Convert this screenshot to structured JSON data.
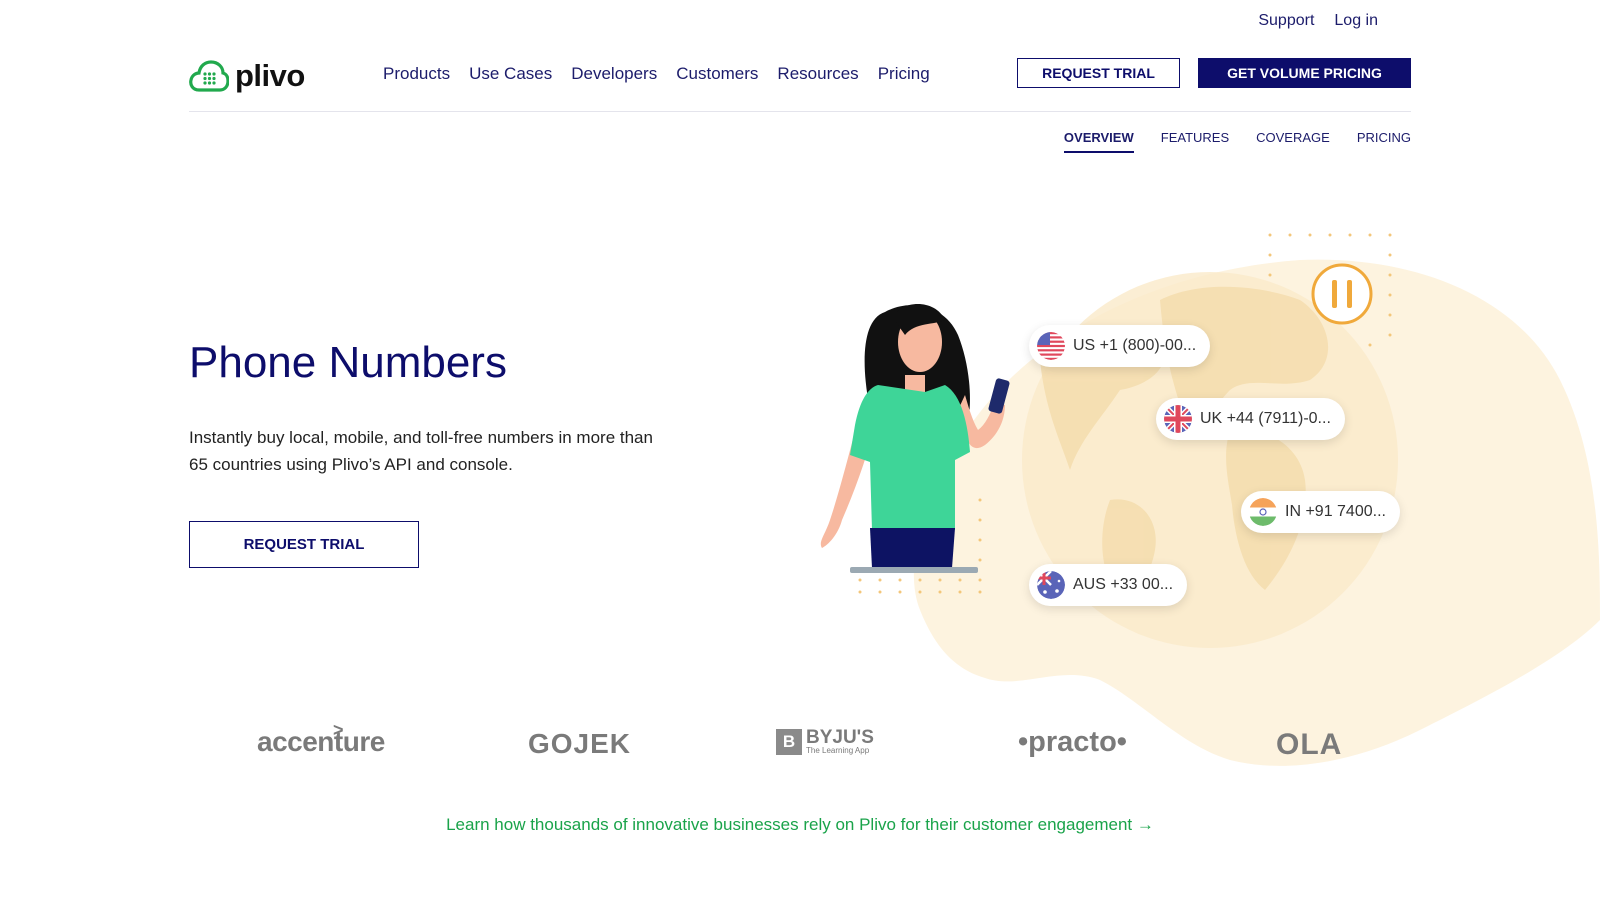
{
  "topbar": {
    "support": "Support",
    "login": "Log in"
  },
  "brand": {
    "name": "plivo",
    "color": "#21a94d"
  },
  "nav": {
    "items": [
      "Products",
      "Use Cases",
      "Developers",
      "Customers",
      "Resources",
      "Pricing"
    ]
  },
  "header_buttons": {
    "request_trial": "REQUEST TRIAL",
    "volume_pricing": "GET VOLUME PRICING"
  },
  "subnav": {
    "items": [
      "OVERVIEW",
      "FEATURES",
      "COVERAGE",
      "PRICING"
    ],
    "active": "OVERVIEW"
  },
  "hero": {
    "title": "Phone Numbers",
    "description": "Instantly buy local, mobile, and toll-free numbers in more than 65 countries using Plivo’s API and console.",
    "button": "REQUEST TRIAL"
  },
  "numbers": {
    "us": "US +1 (800)-00...",
    "uk": "UK +44 (7911)-0...",
    "in": "IN +91 7400...",
    "aus": "AUS +33 00..."
  },
  "customer_logos": [
    "accenture",
    "GOJEK",
    "BYJU'S",
    "The Learning App",
    "practo",
    "OLA"
  ],
  "cta": {
    "text": "Learn how thousands of innovative businesses rely on Plivo for their customer engagement →"
  },
  "colors": {
    "navy": "#0d0d6b",
    "green": "#21a94d",
    "cream": "#fdf3df",
    "shirt": "#3ed598",
    "pause": "#f0a93b"
  },
  "icons": [
    "cloud-grid-logo-icon",
    "pause-icon",
    "us-flag-icon",
    "uk-flag-icon",
    "india-flag-icon",
    "australia-flag-icon"
  ]
}
